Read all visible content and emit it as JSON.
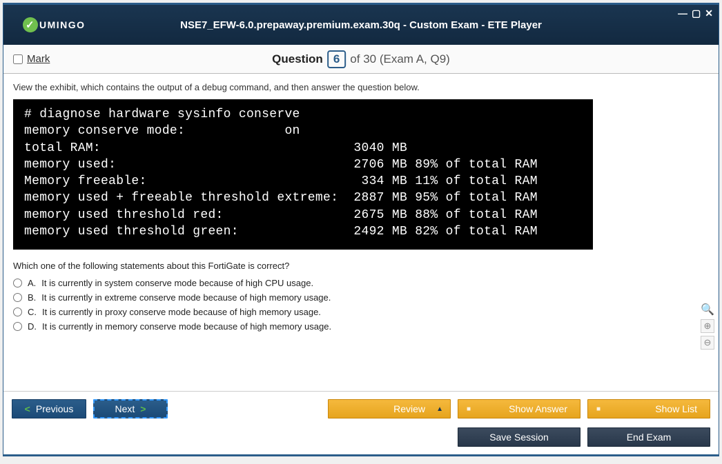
{
  "logo_text": "UMINGO",
  "window_title": "NSE7_EFW-6.0.prepaway.premium.exam.30q - Custom Exam - ETE Player",
  "mark_label": "Mark",
  "question_label": "Question",
  "question_number": "6",
  "question_total": "of 30 (Exam A, Q9)",
  "instruction": "View the exhibit, which contains the output of a debug command, and then answer the question below.",
  "terminal_lines": "# diagnose hardware sysinfo conserve\nmemory conserve mode:             on\ntotal RAM:                                 3040 MB\nmemory used:                               2706 MB 89% of total RAM\nMemory freeable:                            334 MB 11% of total RAM\nmemory used + freeable threshold extreme:  2887 MB 95% of total RAM\nmemory used threshold red:                 2675 MB 88% of total RAM\nmemory used threshold green:               2492 MB 82% of total RAM",
  "question_text": "Which one of the following statements about this FortiGate is correct?",
  "options": [
    {
      "letter": "A.",
      "text": "It is currently in system conserve mode because of high CPU usage."
    },
    {
      "letter": "B.",
      "text": "It is currently in extreme conserve mode because of high memory usage."
    },
    {
      "letter": "C.",
      "text": "It is currently in proxy conserve mode because of high memory usage."
    },
    {
      "letter": "D.",
      "text": "It is currently in memory conserve mode because of high memory usage."
    }
  ],
  "buttons": {
    "previous": "Previous",
    "next": "Next",
    "review": "Review",
    "show_answer": "Show Answer",
    "show_list": "Show List",
    "save_session": "Save Session",
    "end_exam": "End Exam"
  }
}
